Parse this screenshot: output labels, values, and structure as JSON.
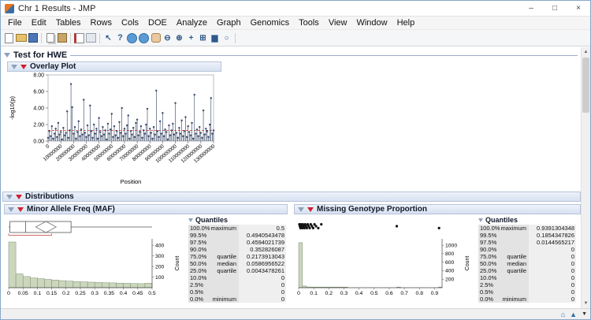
{
  "window": {
    "title": "Chr 1 Results - JMP",
    "controls": {
      "minimize": "–",
      "maximize": "□",
      "close": "×"
    }
  },
  "menu": {
    "items": [
      "File",
      "Edit",
      "Tables",
      "Rows",
      "Cols",
      "DOE",
      "Analyze",
      "Graph",
      "Genomics",
      "Tools",
      "View",
      "Window",
      "Help"
    ]
  },
  "toolbar": {
    "icons": [
      {
        "name": "new-file-icon",
        "cls": "i-new",
        "glyph": ""
      },
      {
        "name": "open-icon",
        "cls": "i-open",
        "glyph": ""
      },
      {
        "name": "save-icon",
        "cls": "i-save",
        "glyph": ""
      },
      {
        "type": "sep"
      },
      {
        "name": "copy-icon",
        "cls": "i-copy",
        "glyph": ""
      },
      {
        "name": "paste-icon",
        "cls": "i-paste",
        "glyph": ""
      },
      {
        "type": "sep"
      },
      {
        "name": "journal-icon",
        "cls": "i-journal",
        "glyph": ""
      },
      {
        "name": "layout-icon",
        "cls": "i-layout",
        "glyph": ""
      },
      {
        "type": "sep"
      },
      {
        "name": "arrow-tool-icon",
        "cls": "i-glyph",
        "glyph": "↖"
      },
      {
        "name": "help-tool-icon",
        "cls": "i-help",
        "glyph": "?"
      },
      {
        "name": "brush-tool-icon",
        "cls": "i-globe",
        "glyph": ""
      },
      {
        "name": "scroller-tool-icon",
        "cls": "i-globe",
        "glyph": ""
      },
      {
        "name": "grabber-hand-tool-icon",
        "cls": "i-hand",
        "glyph": ""
      },
      {
        "name": "zoom-out-tool-icon",
        "cls": "i-glyph",
        "glyph": "⊖"
      },
      {
        "name": "zoom-in-tool-icon",
        "cls": "i-glyph",
        "glyph": "⊕"
      },
      {
        "name": "crosshair-tool-icon",
        "cls": "i-glyph",
        "glyph": "+"
      },
      {
        "name": "table-tool-icon",
        "cls": "i-glyph",
        "glyph": "⊞"
      },
      {
        "name": "chart-tool-icon",
        "cls": "i-glyph",
        "glyph": "▆"
      },
      {
        "name": "lasso-tool-icon",
        "cls": "i-glyph",
        "glyph": "○"
      },
      {
        "type": "sep"
      }
    ]
  },
  "outlines": {
    "test_for_hwe": "Test for HWE",
    "overlay_plot": "Overlay Plot",
    "distributions": "Distributions",
    "maf": "Minor Allele Freq (MAF)",
    "missing": "Missing Genotype Proportion"
  },
  "quantiles": {
    "title": "Quantiles",
    "maf_rows": [
      {
        "pct": "100.0%",
        "label": "maximum",
        "value": "0.5"
      },
      {
        "pct": "99.5%",
        "label": "",
        "value": "0.4940543478"
      },
      {
        "pct": "97.5%",
        "label": "",
        "value": "0.4594021739"
      },
      {
        "pct": "90.0%",
        "label": "",
        "value": "0.352826087"
      },
      {
        "pct": "75.0%",
        "label": "quartile",
        "value": "0.2173913043"
      },
      {
        "pct": "50.0%",
        "label": "median",
        "value": "0.0586956522"
      },
      {
        "pct": "25.0%",
        "label": "quartile",
        "value": "0.0043478261"
      },
      {
        "pct": "10.0%",
        "label": "",
        "value": "0"
      },
      {
        "pct": "2.5%",
        "label": "",
        "value": "0"
      },
      {
        "pct": "0.5%",
        "label": "",
        "value": "0"
      },
      {
        "pct": "0.0%",
        "label": "minimum",
        "value": "0"
      }
    ],
    "missing_rows": [
      {
        "pct": "100.0%",
        "label": "maximum",
        "value": "0.9391304348"
      },
      {
        "pct": "99.5%",
        "label": "",
        "value": "0.1854347826"
      },
      {
        "pct": "97.5%",
        "label": "",
        "value": "0.0144565217"
      },
      {
        "pct": "90.0%",
        "label": "",
        "value": "0"
      },
      {
        "pct": "75.0%",
        "label": "quartile",
        "value": "0"
      },
      {
        "pct": "50.0%",
        "label": "median",
        "value": "0"
      },
      {
        "pct": "25.0%",
        "label": "quartile",
        "value": "0"
      },
      {
        "pct": "10.0%",
        "label": "",
        "value": "0"
      },
      {
        "pct": "2.5%",
        "label": "",
        "value": "0"
      },
      {
        "pct": "0.5%",
        "label": "",
        "value": "0"
      },
      {
        "pct": "0.0%",
        "label": "minimum",
        "value": "0"
      }
    ]
  },
  "chart_data": [
    {
      "id": "overlay",
      "type": "scatter",
      "title": "Overlay Plot",
      "xlabel": "Position",
      "ylabel": "-log10(p)",
      "ylim": [
        0,
        8
      ],
      "ytick_values": [
        0,
        2,
        4,
        6,
        8
      ],
      "yticks": [
        "0.00",
        "2.00",
        "4.00",
        "6.00",
        "8.00"
      ],
      "xticks": [
        0,
        10000000,
        20000000,
        30000000,
        40000000,
        50000000,
        60000000,
        70000000,
        80000000,
        90000000,
        100000000,
        110000000,
        120000000,
        130000000
      ],
      "x_step": 1000000,
      "threshold": 1.3,
      "threshold_color": "#d03a3a",
      "values": [
        0.4,
        1.2,
        0.6,
        1.8,
        0.3,
        0.9,
        1.5,
        0.5,
        2.2,
        0.8,
        1.1,
        0.2,
        1.6,
        0.7,
        1.0,
        3.6,
        0.4,
        1.3,
        6.9,
        4.1,
        0.9,
        1.7,
        0.3,
        1.1,
        2.4,
        0.6,
        1.4,
        0.8,
        5.0,
        1.0,
        0.5,
        1.9,
        0.7,
        4.3,
        1.2,
        0.4,
        2.0,
        0.9,
        1.5,
        0.3,
        2.8,
        1.1,
        0.6,
        1.7,
        0.8,
        1.3,
        0.2,
        2.1,
        0.9,
        1.4,
        3.3,
        0.5,
        1.8,
        0.7,
        1.2,
        0.4,
        2.3,
        1.0,
        4.0,
        0.6,
        1.5,
        0.9,
        1.9,
        3.1,
        0.3,
        1.2,
        0.8,
        1.6,
        0.5,
        2.2,
        2.6,
        0.7,
        1.1,
        1.8,
        0.4,
        1.3,
        0.9,
        2.0,
        3.9,
        0.6,
        1.5,
        1.0,
        0.3,
        1.7,
        0.8,
        6.1,
        1.2,
        0.5,
        2.4,
        0.9,
        3.4,
        0.6,
        1.4,
        1.1,
        0.2,
        1.9,
        0.7,
        1.3,
        2.1,
        0.8,
        4.6,
        1.0,
        0.4,
        1.6,
        0.9,
        2.5,
        0.6,
        1.2,
        2.9,
        0.5,
        1.8,
        1.1,
        0.7,
        2.2,
        0.3,
        5.6,
        0.9,
        1.4,
        0.6,
        1.7,
        1.0,
        0.4,
        3.7,
        0.8,
        1.5,
        1.2,
        0.5,
        2.0,
        5.2,
        0.9,
        1.3
      ]
    },
    {
      "id": "maf",
      "type": "bar",
      "title": "Minor Allele Freq (MAF)",
      "ylabel": "Count",
      "bin_start": 0,
      "bin_width": 0.025,
      "x_max": 0.5,
      "xticks": [
        0,
        0.05,
        0.1,
        0.15,
        0.2,
        0.25,
        0.3,
        0.35,
        0.4,
        0.45,
        0.5
      ],
      "ylim": [
        0,
        460
      ],
      "yticks": [
        100,
        200,
        300,
        400
      ],
      "counts": [
        430,
        130,
        105,
        92,
        85,
        78,
        72,
        66,
        62,
        58,
        55,
        52,
        49,
        47,
        45,
        43,
        41,
        39,
        38,
        42
      ],
      "boxplot": {
        "min": 0,
        "q1": 0.0043478261,
        "median": 0.0586956522,
        "q3": 0.2173913043,
        "max": 0.5,
        "mean": 0.13
      },
      "shortest_half": [
        0,
        0.15
      ]
    },
    {
      "id": "missing",
      "type": "bar",
      "title": "Missing Genotype Proportion",
      "ylabel": "Count",
      "bin_start": 0,
      "bin_width": 0.025,
      "x_max": 0.95,
      "xticks": [
        0,
        0.1,
        0.2,
        0.3,
        0.4,
        0.5,
        0.6,
        0.7,
        0.8,
        0.9
      ],
      "ylim": [
        0,
        1150
      ],
      "yticks": [
        200,
        400,
        600,
        800,
        1000
      ],
      "counts": [
        1060,
        40,
        18,
        10,
        6,
        4,
        3,
        2,
        2,
        1,
        1,
        1,
        1,
        0,
        0,
        0,
        0,
        0,
        0,
        0,
        0,
        0,
        0,
        0,
        0,
        0,
        1,
        0,
        0,
        0,
        0,
        0,
        0,
        0,
        0,
        0,
        0,
        1
      ],
      "outliers": [
        0.005,
        0.008,
        0.012,
        0.016,
        0.02,
        0.024,
        0.028,
        0.033,
        0.038,
        0.043,
        0.048,
        0.054,
        0.06,
        0.066,
        0.073,
        0.08,
        0.088,
        0.096,
        0.105,
        0.115,
        0.13,
        0.15,
        0.65,
        0.93
      ]
    }
  ],
  "statusbar": {
    "icons": [
      {
        "name": "home-icon",
        "glyph": "⌂"
      },
      {
        "name": "scroll-up-icon",
        "glyph": "▲"
      },
      {
        "name": "menu-caret-icon",
        "glyph": "▼"
      }
    ]
  },
  "scrollbar": {
    "up": "▲",
    "down": "▼"
  }
}
